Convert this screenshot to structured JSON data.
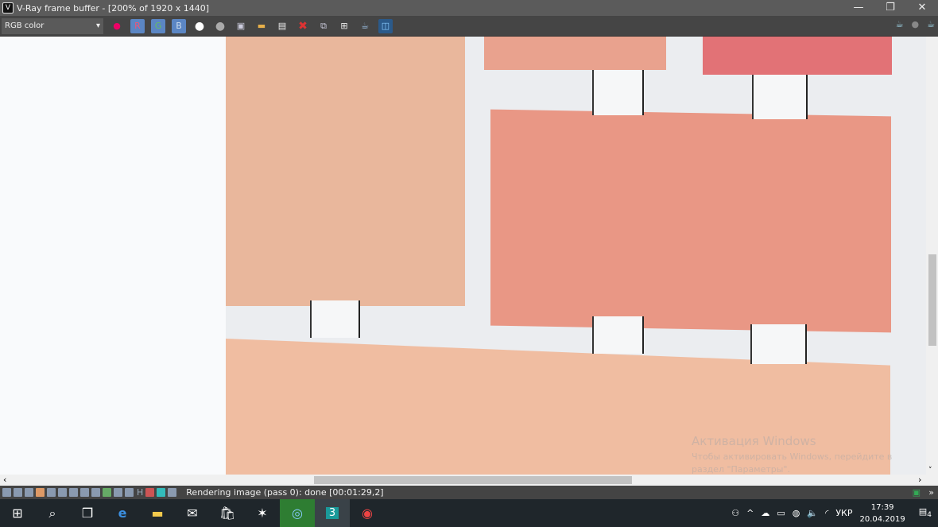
{
  "window": {
    "title": "V-Ray frame buffer - [200% of 1920 x 1440]",
    "minimize": "—",
    "restore": "❐",
    "close": "✕"
  },
  "toolbar": {
    "channel_select": "RGB color",
    "r": "R",
    "g": "G",
    "b": "B"
  },
  "status": {
    "text": "Rendering image (pass 0): done [00:01:29,2]",
    "h_label": "H"
  },
  "watermark": {
    "title": "Активация Windows",
    "line1": "Чтобы активировать Windows, перейдите в",
    "line2": "раздел \"Параметры\"."
  },
  "taskbar": {
    "language": "УКР",
    "time": "17:39",
    "date": "20.04.2019",
    "notifications": "4",
    "app_3ds": "3"
  }
}
